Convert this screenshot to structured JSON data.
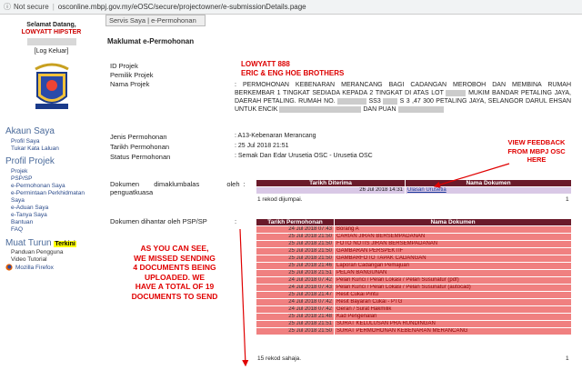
{
  "browser": {
    "security": "Not secure",
    "url": "osconline.mbpj.gov.my/eOSC/secure/projectowner/e-submissionDetails.page"
  },
  "sidebar": {
    "welcome": "Selamat Datang,",
    "username": "LOWYATT HIPSTER",
    "logout": "[Log Keluar]",
    "akaun_saya": "Akaun Saya",
    "akaun_links": [
      "Profil Saya",
      "Tukar Kata Laluan"
    ],
    "profil_projek": "Profil Projek",
    "projek_links": [
      "Projek",
      "PSP/SP",
      "e-Permohonan Saya",
      "e-Permintaan Perkhidmatan",
      "Saya",
      "e-Aduan Saya",
      "e-Tanya Saya",
      "Bantuan",
      "FAQ"
    ],
    "muat_turun": "Muat Turun",
    "terkini": "Terkini",
    "muat_links": [
      "Panduan Pengguna",
      "Video Tutorial",
      "Mozilla Firefox"
    ]
  },
  "tab": "Servis Saya | e-Permohonan",
  "maklumat": {
    "title": "Maklumat e-Permohonan",
    "id_label": "ID Projek",
    "id_value": "LOWYATT 888",
    "pemilik_label": "Pemilik Projek",
    "pemilik_value": "ERIC & ENG HOE BROTHERS",
    "nama_label": "Nama Projek",
    "nama_p1": "PERMOHONAN KEBENARAN MERANCANG BAGI CADANGAN MEROBOH DAN MEMBINA RUMAH BERKEMBAR 1 TINGKAT SEDIADA KEPADA 2 TINGKAT DI ATAS LOT",
    "nama_p2": "MUKIM BANDAR PETALING JAYA, DAERAH PETALING. RUMAH NO.",
    "nama_p3": "SS3",
    "nama_p4": "S 3 ,47 300 PETALING JAYA, SELANGOR DARUL EHSAN UNTUK ENCIK",
    "nama_p5": "DAN PUAN",
    "jenis_label": "Jenis Permohonan",
    "jenis_value": ": A13-Kebenaran Merancang",
    "tarikh_label": "Tarikh Permohonan",
    "tarikh_value": ": 25 Jul 2018 21:51",
    "status_label": "Status Permohonan",
    "status_value": ": Semak Dan Edar Urusetia OSC  - Urusetia OSC"
  },
  "dikembalikan": {
    "label_a": "Dokumen",
    "label_b": "dimaklumbalas",
    "label_c": "oleh",
    "label_d": ":",
    "label_e": "penguatkuasa",
    "headers": [
      "Tarikh Diterima",
      "Nama Dokumen"
    ],
    "rows": [
      [
        "26 Jul 2018 14:31",
        "Ulasan Urusetia"
      ]
    ],
    "count": "1 rekod dijumpai.",
    "page": "1"
  },
  "dihantar": {
    "label": "Dokumen dihantar oleh PSP/SP",
    "colon": ":",
    "headers": [
      "Tarikh Permohonan",
      "Nama Dokumen"
    ],
    "rows": [
      [
        "24 Jul 2018 07:43",
        "Borang A"
      ],
      [
        "25 Jul 2018 21:50",
        "CARIAN JIRAN BERSEMPADANAN"
      ],
      [
        "25 Jul 2018 21:50",
        "FOTO NOTIS JIRAN BERSEMPADANAN"
      ],
      [
        "25 Jul 2018 21:50",
        "GAMBARAN PERSPEKTIF"
      ],
      [
        "25 Jul 2018 21:50",
        "GAMBARFOTO TAPAK CADANGAN"
      ],
      [
        "25 Jul 2018 21:46",
        "Laporan Cadangan Pemajuan"
      ],
      [
        "25 Jul 2018 21:51",
        "PELAN BANGUNAN"
      ],
      [
        "24 Jul 2018 07:42",
        "Pelan Kunci / Pelan Lokasi / Pelan Susunatur (pdf)"
      ],
      [
        "24 Jul 2018 07:43",
        "Pelan Kunci / Pelan Lokasi / Pelan Susunatur (autocad)"
      ],
      [
        "25 Jul 2018 21:47",
        "Resit Cukai Pintu"
      ],
      [
        "24 Jul 2018 07:42",
        "Resit Bayaran Cukai - PTG"
      ],
      [
        "24 Jul 2018 07:42",
        "Geran / Surat Hakmilik"
      ],
      [
        "25 Jul 2018 21:48",
        "Kad Pengenalan"
      ],
      [
        "25 Jul 2018 21:51",
        "SURAT KELULUSAN PRA RUNDINGAN"
      ],
      [
        "25 Jul 2018 21:50",
        "SURAT PERMOHONAN KEBENARAN MERANCANG"
      ]
    ],
    "count": "15 rekod sahaja.",
    "page": "1"
  },
  "annotations": {
    "view_feedback": [
      "VIEW FEEDBACK",
      "FROM MBPJ OSC",
      "HERE"
    ],
    "missed": [
      "AS YOU CAN SEE,",
      "WE MISSED SENDING",
      "4 DOCUMENTS BEING",
      "UPLOADED. WE",
      "HAVE A TOTAL OF 19",
      "DOCUMENTS TO SEND"
    ]
  }
}
